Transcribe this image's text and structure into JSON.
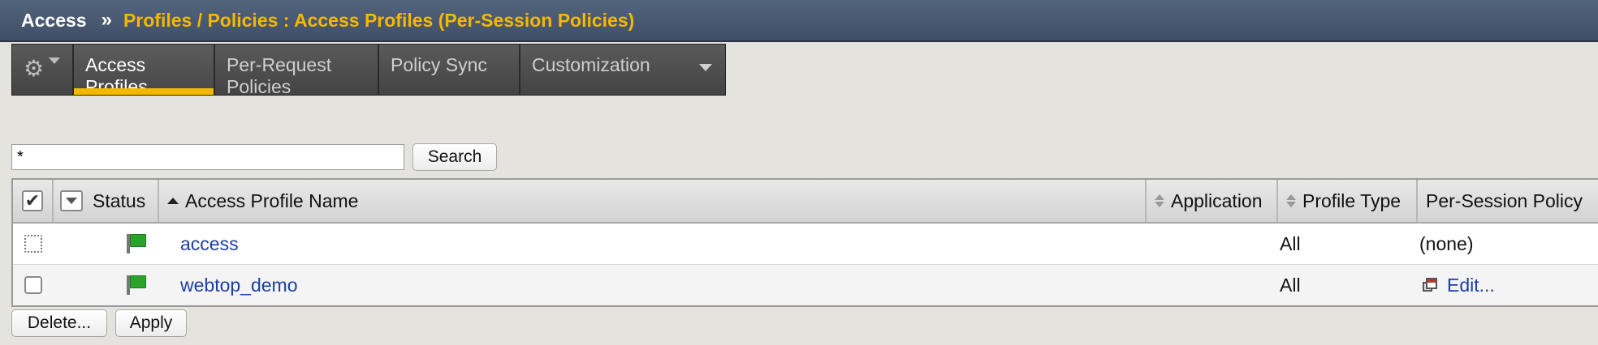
{
  "header": {
    "root": "Access",
    "separator": "»",
    "path": "Profiles / Policies : Access Profiles (Per-Session Policies)"
  },
  "tabs": [
    {
      "label": "Access Profiles",
      "active": true
    },
    {
      "label": "Per-Request Policies",
      "active": false
    },
    {
      "label": "Policy Sync",
      "active": false
    },
    {
      "label": "Customization",
      "active": false,
      "has_dropdown": true
    }
  ],
  "search": {
    "value": "*",
    "button_label": "Search"
  },
  "table": {
    "columns": {
      "status": "Status",
      "name": "Access Profile Name",
      "application": "Application",
      "profile_type": "Profile Type",
      "per_session_policy": "Per-Session Policy"
    },
    "rows": [
      {
        "name": "access",
        "application": "",
        "profile_type": "All",
        "policy": "(none)",
        "policy_is_link": false
      },
      {
        "name": "webtop_demo",
        "application": "",
        "profile_type": "All",
        "policy": "Edit...",
        "policy_is_link": true
      }
    ]
  },
  "actions": {
    "delete_label": "Delete...",
    "apply_label": "Apply"
  },
  "colors": {
    "header_bg": "#4a5a70",
    "path_text": "#f5b800",
    "active_tab_underline": "#f5b800",
    "link": "#1b3ea8",
    "status_flag": "#2aa32a"
  },
  "icons": {
    "gear": "gear-icon",
    "status": "green-flag-icon",
    "edit": "edit-window-icon"
  }
}
